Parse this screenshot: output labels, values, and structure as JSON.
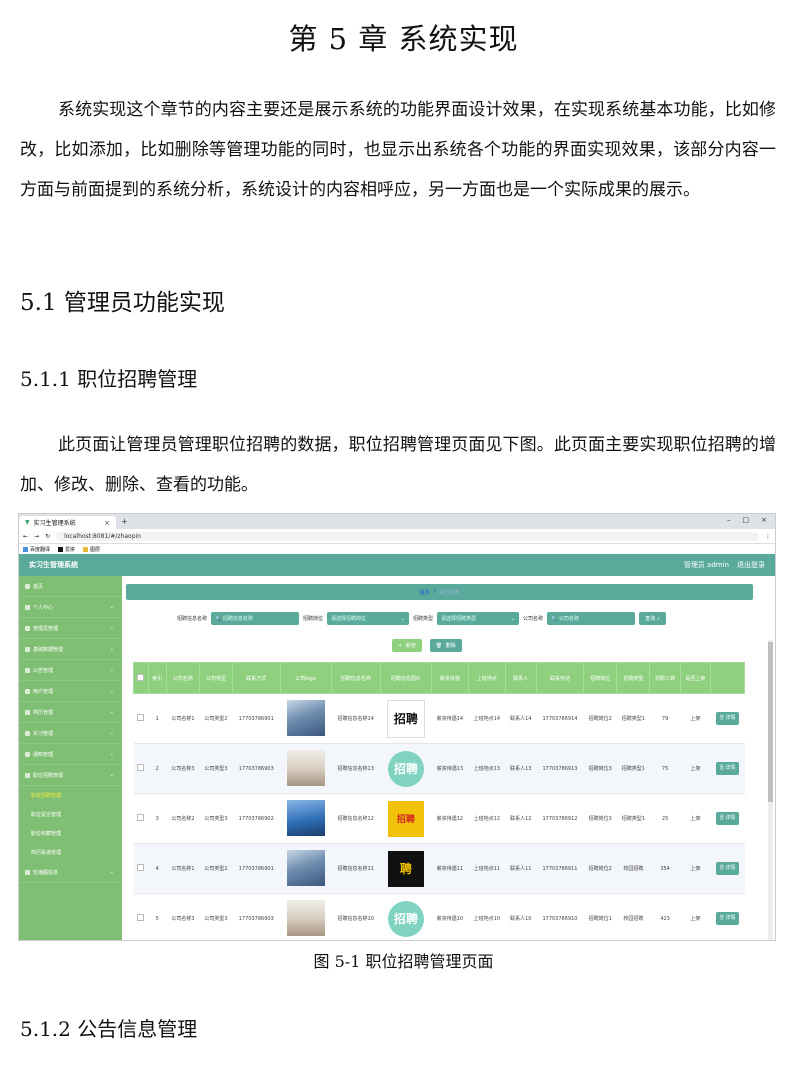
{
  "chapter_title": "第 5 章  系统实现",
  "intro_paragraph": "系统实现这个章节的内容主要还是展示系统的功能界面设计效果，在实现系统基本功能，比如修改，比如添加，比如删除等管理功能的同时，也显示出系统各个功能的界面实现效果，该部分内容一方面与前面提到的系统分析，系统设计的内容相呼应，另一方面也是一个实际成果的展示。",
  "section_5_1": "5.1 管理员功能实现",
  "section_5_1_1": "5.1.1  职位招聘管理",
  "section_5_1_1_paragraph": "此页面让管理员管理职位招聘的数据，职位招聘管理页面见下图。此页面主要实现职位招聘的增加、修改、删除、查看的功能。",
  "figure_caption": "图 5-1  职位招聘管理页面",
  "section_5_1_2": "5.1.2  公告信息管理",
  "screenshot": {
    "tab_title": "实习生管理系统",
    "url": "localhost:8081/#/zhaopin",
    "bookmarks": [
      "百度翻译",
      "爱拼",
      "图层"
    ],
    "app_title": "实习生管理系统",
    "admin_label": "管理员 admin",
    "logout_label": "退出登录",
    "sidebar": [
      {
        "label": "首页",
        "sub": false
      },
      {
        "label": "个人中心",
        "sub": false,
        "arrow": true
      },
      {
        "label": "管理员管理",
        "sub": false,
        "arrow": true
      },
      {
        "label": "基础数据管理",
        "sub": false,
        "arrow": true
      },
      {
        "label": "公告管理",
        "sub": false,
        "arrow": true
      },
      {
        "label": "用户管理",
        "sub": false,
        "arrow": true
      },
      {
        "label": "简历管理",
        "sub": false,
        "arrow": true
      },
      {
        "label": "实习管理",
        "sub": false,
        "arrow": true
      },
      {
        "label": "通知管理",
        "sub": false,
        "arrow": true
      },
      {
        "label": "职位招聘管理",
        "sub": false,
        "arrow": true
      },
      {
        "label": "职位招聘管理",
        "sub": true,
        "active": true
      },
      {
        "label": "职位留言管理",
        "sub": true
      },
      {
        "label": "职位收藏管理",
        "sub": true
      },
      {
        "label": "简历投递管理",
        "sub": true
      },
      {
        "label": "轮播图信息",
        "sub": false,
        "arrow": true
      }
    ],
    "breadcrumb": {
      "home": "首页",
      "sep": "/",
      "current": "职位招聘"
    },
    "search": {
      "field1_label": "招聘信息名称",
      "field1_placeholder": "招聘信息名称",
      "field2_label": "招聘岗位",
      "field2_placeholder": "请选择招聘岗位",
      "field3_label": "招聘类型",
      "field3_placeholder": "请选择招聘类型",
      "field4_label": "公司名称",
      "field4_placeholder": "公司名称",
      "query_button": "查询"
    },
    "add_button": "新增",
    "delete_button": "删除",
    "columns": [
      "",
      "索引",
      "公司名称",
      "公司类型",
      "联系方式",
      "公司logo",
      "招聘信息名称",
      "招聘信息图片",
      "薪资待遇",
      "上班地点",
      "联系人",
      "联系电话",
      "招聘岗位",
      "招聘类型",
      "招聘人数",
      "是否上架",
      ""
    ],
    "rows": [
      {
        "idx": "1",
        "company": "公司名称1",
        "ctype": "公司类型2",
        "phone": "17703786901",
        "logo": "a",
        "title": "招聘信息名称14",
        "poster": "p1",
        "poster_text": "招聘",
        "salary": "薪资待遇14",
        "place": "上班地点14",
        "contact": "联系人14",
        "tel": "17703786914",
        "job": "招聘岗位2",
        "jtype": "招聘类型1",
        "count": "79",
        "status": "上架",
        "detail": "详情"
      },
      {
        "idx": "2",
        "company": "公司名称3",
        "ctype": "公司类型3",
        "phone": "17703786903",
        "logo": "b",
        "title": "招聘信息名称13",
        "poster": "p2",
        "poster_text": "招聘",
        "salary": "薪资待遇13",
        "place": "上班地点13",
        "contact": "联系人13",
        "tel": "17703786913",
        "job": "招聘岗位3",
        "jtype": "招聘类型1",
        "count": "75",
        "status": "上架",
        "detail": "详情"
      },
      {
        "idx": "3",
        "company": "公司名称2",
        "ctype": "公司类型3",
        "phone": "17703786902",
        "logo": "c",
        "title": "招聘信息名称12",
        "poster": "p3",
        "poster_text": "招聘",
        "salary": "薪资待遇12",
        "place": "上班地点12",
        "contact": "联系人12",
        "tel": "17703786912",
        "job": "招聘岗位3",
        "jtype": "招聘类型1",
        "count": "25",
        "status": "上架",
        "detail": "详情"
      },
      {
        "idx": "4",
        "company": "公司名称1",
        "ctype": "公司类型2",
        "phone": "17703786901",
        "logo": "a",
        "title": "招聘信息名称11",
        "poster": "p4",
        "poster_text": "聘",
        "salary": "薪资待遇11",
        "place": "上班地点11",
        "contact": "联系人11",
        "tel": "17703786911",
        "job": "招聘岗位2",
        "jtype": "校园招聘",
        "count": "354",
        "status": "上架",
        "detail": "详情"
      },
      {
        "idx": "5",
        "company": "公司名称3",
        "ctype": "公司类型3",
        "phone": "17703786903",
        "logo": "b",
        "title": "招聘信息名称10",
        "poster": "p2",
        "poster_text": "招聘",
        "salary": "薪资待遇10",
        "place": "上班地点10",
        "contact": "联系人10",
        "tel": "17703786910",
        "job": "招聘岗位1",
        "jtype": "校园招聘",
        "count": "423",
        "status": "上架",
        "detail": "详情"
      }
    ]
  }
}
